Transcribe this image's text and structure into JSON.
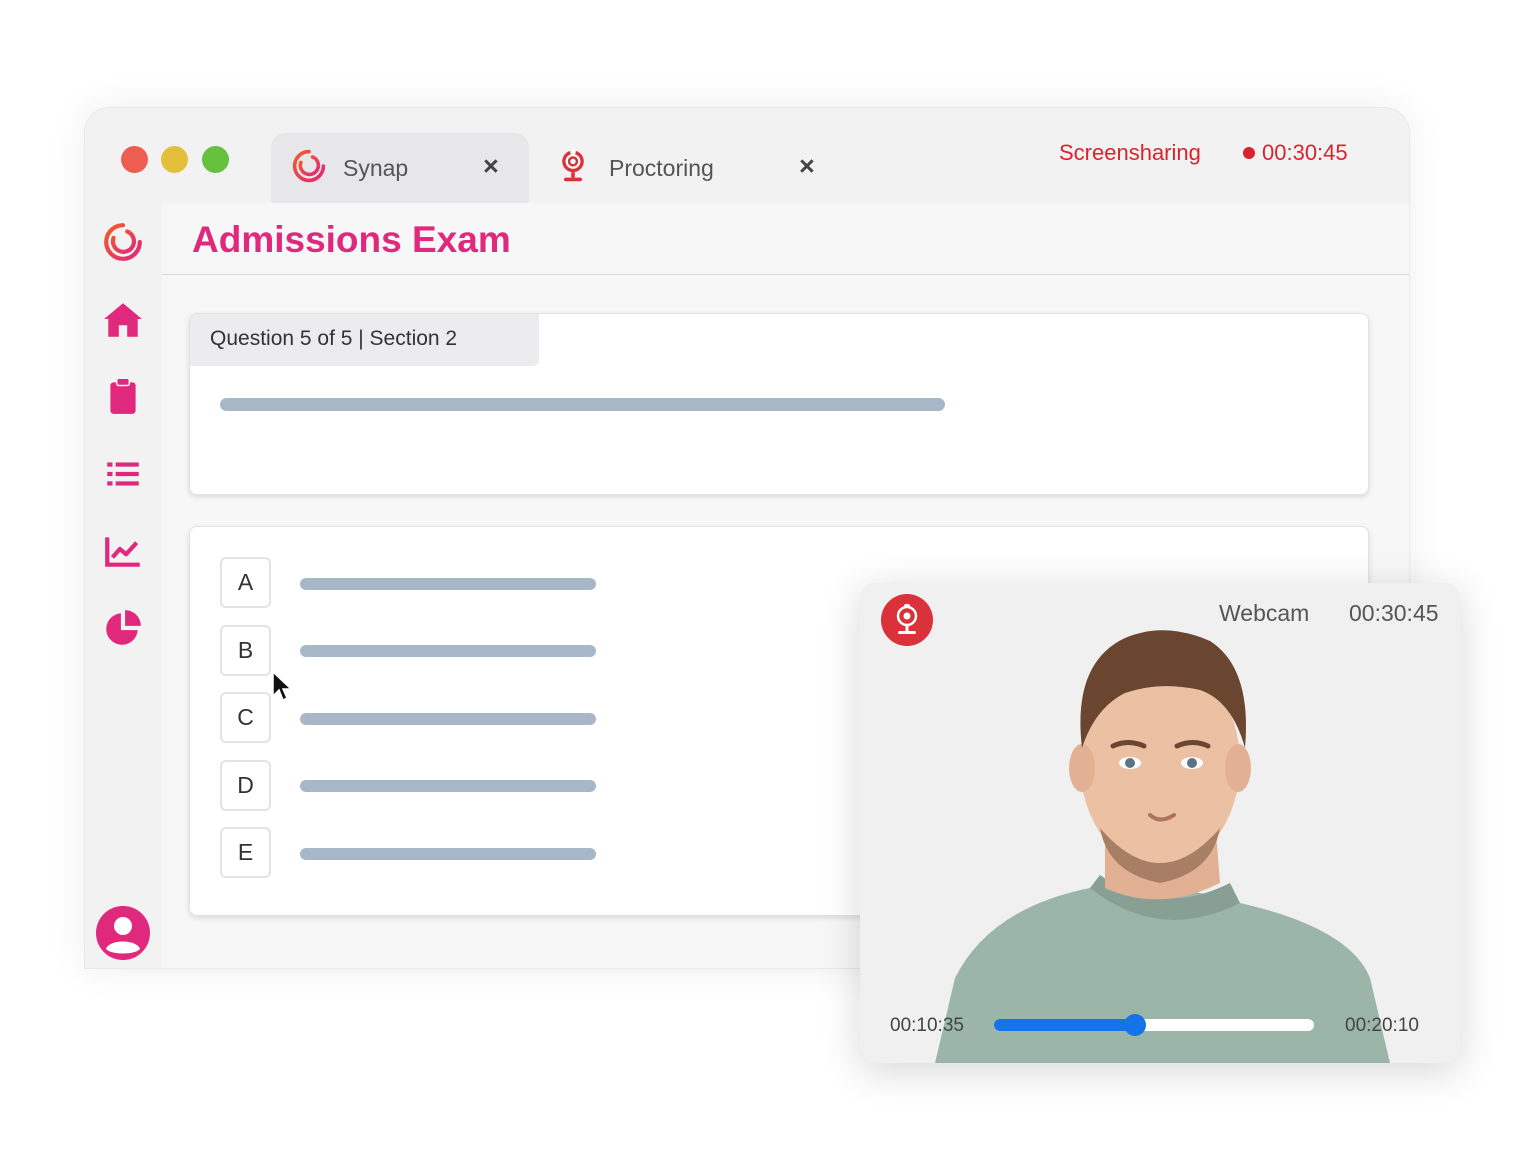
{
  "window": {
    "tabs": [
      {
        "label": "Synap",
        "icon": "synap-logo-icon",
        "active": true
      },
      {
        "label": "Proctoring",
        "icon": "proctoring-webcam-icon",
        "active": false
      }
    ],
    "screensharing_label": "Screensharing",
    "recording_time": "00:30:45"
  },
  "sidebar": {
    "items": [
      {
        "name": "logo",
        "icon": "synap-logo-icon"
      },
      {
        "name": "home",
        "icon": "home-icon"
      },
      {
        "name": "clipboard",
        "icon": "clipboard-icon"
      },
      {
        "name": "list",
        "icon": "list-icon"
      },
      {
        "name": "chart",
        "icon": "line-chart-icon"
      },
      {
        "name": "pie",
        "icon": "pie-chart-icon"
      },
      {
        "name": "profile",
        "icon": "user-avatar-icon"
      }
    ]
  },
  "main": {
    "title": "Admissions Exam",
    "question_tag": "Question 5 of 5 | Section 2",
    "options": [
      "A",
      "B",
      "C",
      "D",
      "E"
    ]
  },
  "webcam": {
    "label": "Webcam",
    "time": "00:30:45",
    "current_time": "00:10:35",
    "end_time": "00:20:10",
    "progress": 0.44
  },
  "colors": {
    "accent": "#e0287c",
    "alert_red": "#d9232d",
    "progress_blue": "#1473e6",
    "placeholder_gray": "#a8b7c8"
  }
}
